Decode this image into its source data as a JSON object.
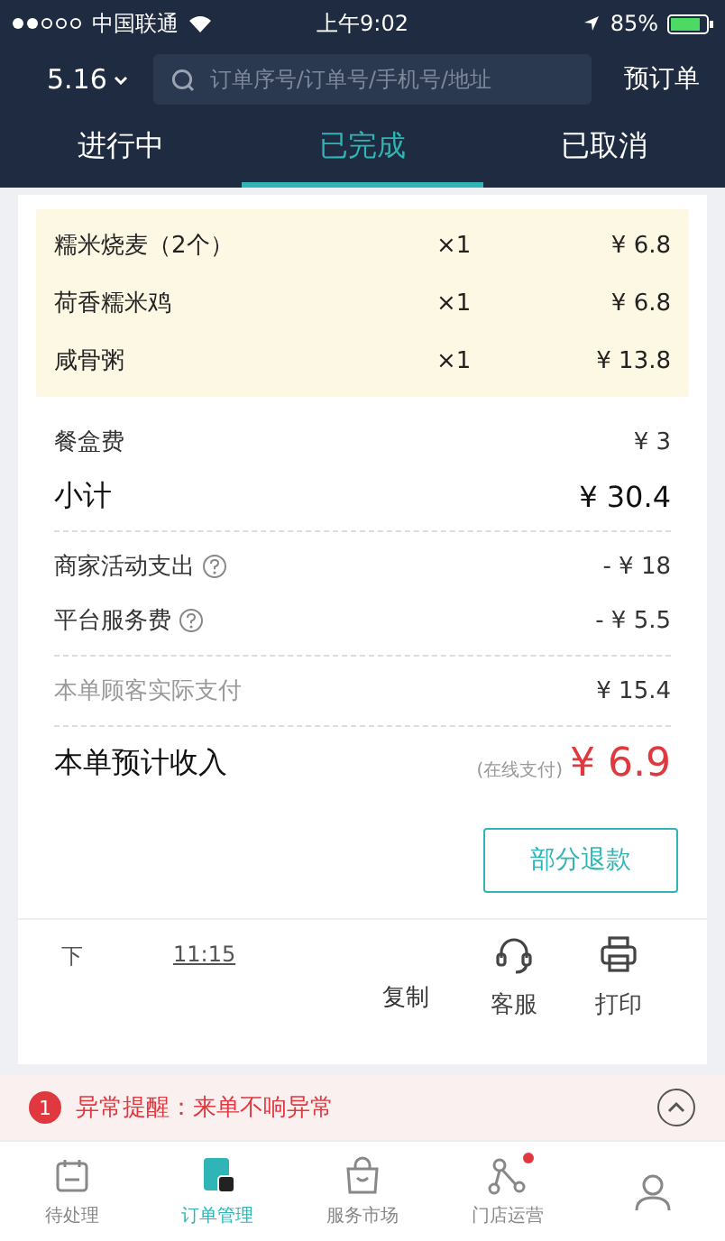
{
  "status_bar": {
    "carrier": "中国联通",
    "time": "上午9:02",
    "battery": "85%"
  },
  "header": {
    "date": "5.16",
    "search": {
      "placeholder": "订单序号/订单号/手机号/地址"
    },
    "action": "预订单"
  },
  "tabs": [
    {
      "label": "进行中",
      "selected": false
    },
    {
      "label": "已完成",
      "selected": true
    },
    {
      "label": "已取消",
      "selected": false
    }
  ],
  "order": {
    "items": [
      {
        "name": "糯米烧麦（2个）",
        "qty": "×1",
        "price": "¥ 6.8"
      },
      {
        "name": "荷香糯米鸡",
        "qty": "×1",
        "price": "¥ 6.8"
      },
      {
        "name": "咸骨粥",
        "qty": "×1",
        "price": "¥ 13.8"
      }
    ],
    "fee_sections": [
      [
        {
          "kind": "normal",
          "label": "餐盒费",
          "amount": "¥ 3"
        },
        {
          "kind": "subtotal",
          "label": "小计",
          "amount": "¥ 30.4"
        }
      ],
      [
        {
          "kind": "help",
          "label": "商家活动支出",
          "amount": "- ¥ 18"
        },
        {
          "kind": "help",
          "label": "平台服务费",
          "amount": "- ¥ 5.5"
        }
      ],
      [
        {
          "kind": "muted",
          "label": "本单顾客实际支付",
          "amount": "¥ 15.4"
        }
      ]
    ],
    "income": {
      "label": "本单预计收入",
      "note": "(在线支付)",
      "amount": "¥ 6.9"
    },
    "refund_button": "部分退款",
    "order_time": {
      "prefix": "下",
      "time": "11:15"
    },
    "copy": "复制",
    "actions": [
      {
        "kind": "headset",
        "label": "客服"
      },
      {
        "kind": "printer",
        "label": "打印"
      }
    ]
  },
  "alert": {
    "count": "1",
    "text": "异常提醒：来单不响异常"
  },
  "bottom_nav": [
    {
      "kind": "calendar",
      "label": "待处理",
      "selected": false,
      "badge": false
    },
    {
      "kind": "clipboard",
      "label": "订单管理",
      "selected": true,
      "badge": false
    },
    {
      "kind": "bag",
      "label": "服务市场",
      "selected": false,
      "badge": false
    },
    {
      "kind": "nodes",
      "label": "门店运营",
      "selected": false,
      "badge": true
    },
    {
      "kind": "person",
      "selected": false,
      "badge": false
    }
  ]
}
